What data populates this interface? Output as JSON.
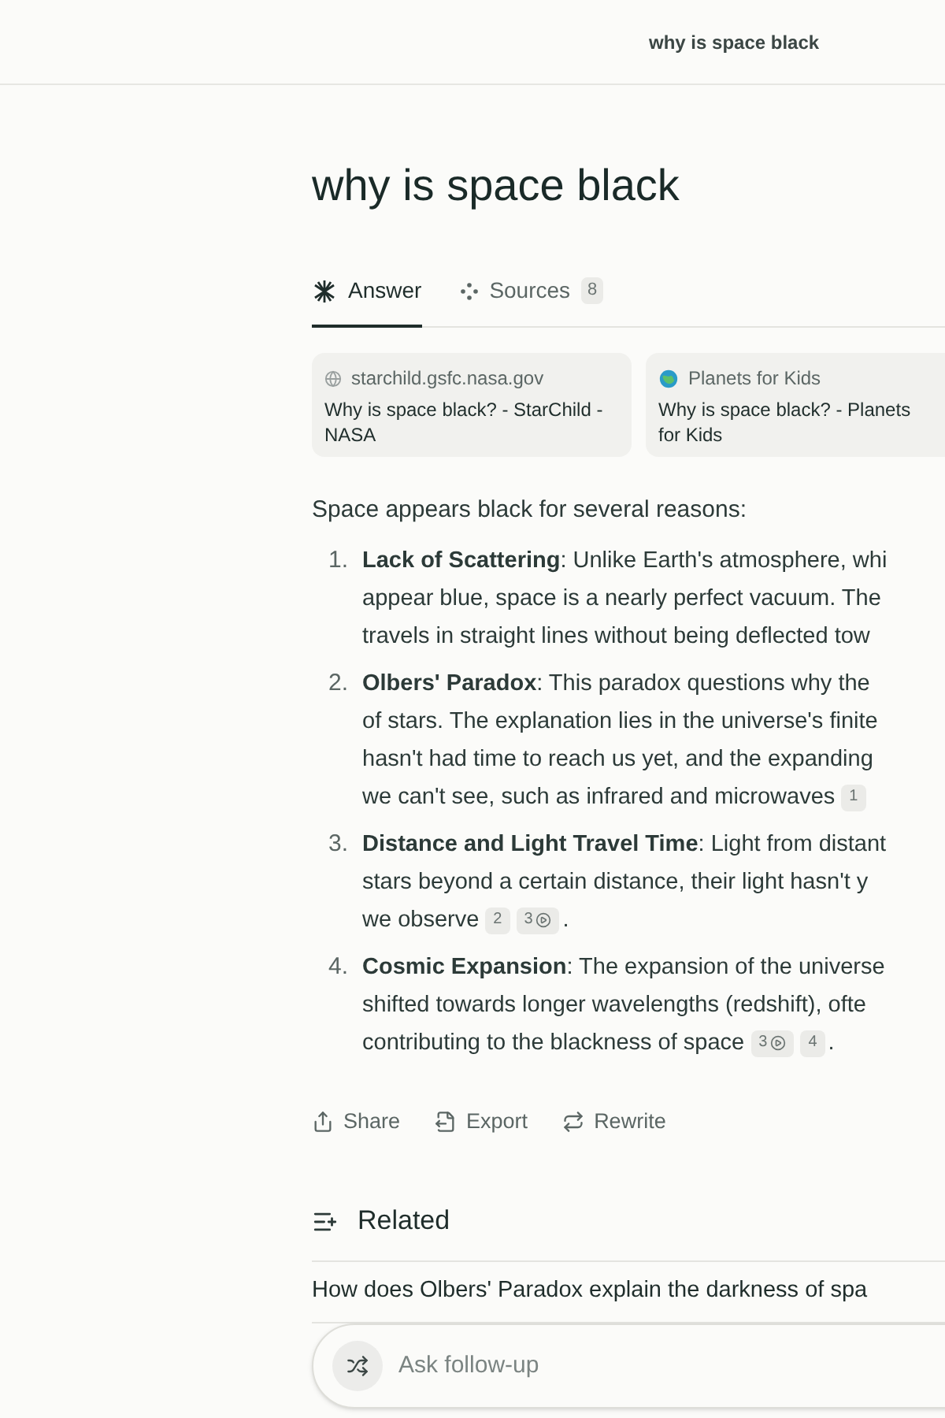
{
  "header": {
    "title": "why is space black"
  },
  "query": "why is space black",
  "tabs": [
    {
      "label": "Answer",
      "selected": true,
      "kind": "answer"
    },
    {
      "label": "Sources",
      "selected": false,
      "kind": "sources",
      "count": "8"
    }
  ],
  "sources": [
    {
      "site": "starchild.gsfc.nasa.gov",
      "title_lines": [
        "Why is space black? - StarChild -",
        "NASA"
      ],
      "kind": "globe"
    },
    {
      "site": "Planets for Kids",
      "title_lines": [
        "Why is space black? - Planets",
        "for Kids"
      ],
      "kind": "planet"
    }
  ],
  "intro": "Space appears black for several reasons:",
  "items": [
    {
      "number": "1.",
      "lines": [
        "**Lack of Scattering**: Unlike Earth's atmosphere, whi",
        "appear blue, space is a nearly perfect vacuum. The",
        "travels in straight lines without being deflected tow"
      ]
    },
    {
      "number": "2.",
      "lines": [
        "**Olbers' Paradox**: This paradox questions why the",
        "of stars. The explanation lies in the universe's finite",
        "hasn't had time to reach us yet, and the expanding",
        "we can't see, such as infrared and microwaves"
      ],
      "citations": [
        {
          "label": "1",
          "kind": "plain"
        }
      ]
    },
    {
      "number": "3.",
      "lines": [
        "**Distance and Light Travel Time**: Light from distant",
        "stars beyond a certain distance, their light hasn't y",
        "we observe"
      ],
      "citations": [
        {
          "label": "2",
          "kind": "plain"
        },
        {
          "label": "3",
          "kind": "video"
        }
      ],
      "end": "."
    },
    {
      "number": "4.",
      "lines": [
        "**Cosmic Expansion**: The expansion of the universe",
        "shifted towards longer wavelengths (redshift), ofte",
        "contributing to the blackness of space"
      ],
      "citations": [
        {
          "label": "3",
          "kind": "video"
        },
        {
          "label": "4",
          "kind": "plain"
        }
      ],
      "end": "."
    }
  ],
  "actions": [
    {
      "label": "Share",
      "kind": "share"
    },
    {
      "label": "Export",
      "kind": "export"
    },
    {
      "label": "Rewrite",
      "kind": "rewrite"
    }
  ],
  "related": {
    "title": "Related",
    "items": [
      "How does Olbers' Paradox explain the darkness of spa"
    ]
  },
  "follow_up": {
    "placeholder": "Ask follow-up"
  }
}
